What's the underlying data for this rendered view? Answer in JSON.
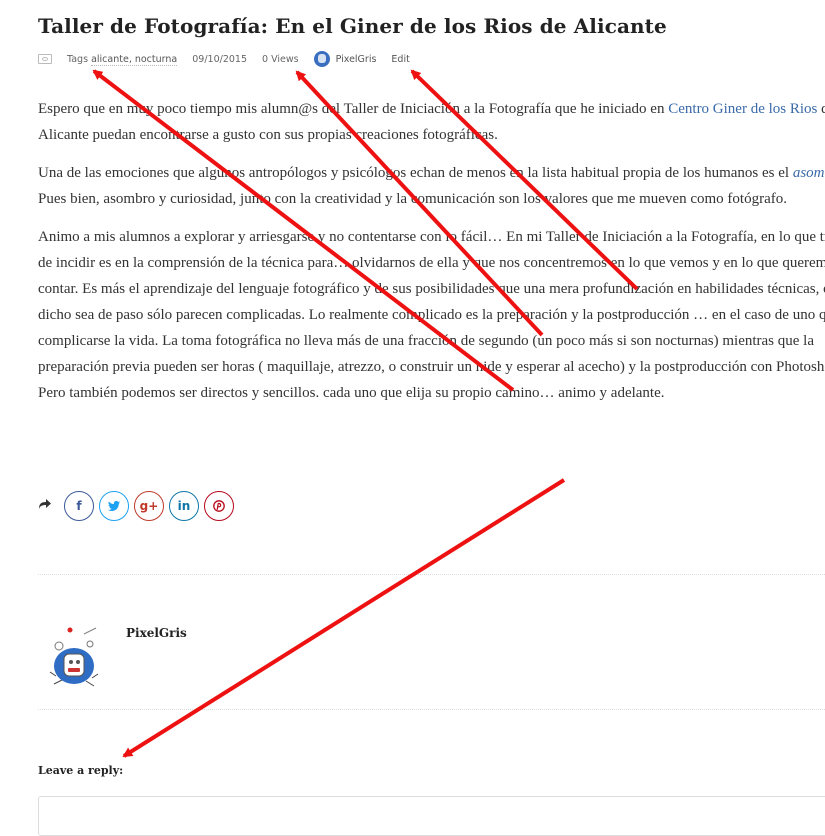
{
  "post": {
    "title": "Taller de Fotografía: En el Giner de los Rios de Alicante",
    "meta": {
      "tags_label": "Tags",
      "tags": "alicante, nocturna",
      "date": "09/10/2015",
      "views": "0 Views",
      "author": "PixelGris",
      "edit": "Edit"
    },
    "p1": {
      "before": "Espero que en muy poco tiempo mis alumn@s del Taller de Iniciación a la Fotografía que he iniciado en ",
      "link": "Centro Giner de los Rios",
      "after": " de Alicante puedan encontrarse a gusto con sus propias creaciones fotográficas."
    },
    "p2": {
      "before": "Una de las emociones que algunos antropólogos y psicólogos echan de menos en la lista habitual propia de los humanos es el ",
      "emph": "asombro",
      "after": ". Pues bien, asombro y curiosidad, junto con la creatividad y la comunicación son los valores que me mueven como fotógrafo."
    },
    "p3": "Animo a mis alumnos a explorar y arriesgarse y no contentarse con lo fácil… En mi Taller de Iniciación a la Fotografía, en lo que trato de incidir es en la comprensión de la técnica para… olvidarnos de ella y que nos concentremos en lo que vemos y en lo que queremos contar. Es más el aprendizaje del lenguaje fotográfico y de sus posibilidades que una mera profundización en habilidades técnicas, que dicho sea de paso sólo parecen complicadas. Lo realmente complicado es la preparación y la postproducción … en el caso de uno quiera complicarse la vida. La toma fotográfica no lleva más de una fracción de segundo (un poco más si son nocturnas) mientras que la preparación previa pueden ser horas ( maquillaje, atrezzo, o construir un hide y esperar al acecho) y la postproducción con Photoshop…  Pero también podemos ser directos  y sencillos. cada uno que elija su propio camino… animo y adelante."
  },
  "share": {
    "share_icon": "share-arrow-icon",
    "buttons": [
      {
        "icon": "facebook-icon",
        "glyph": "f"
      },
      {
        "icon": "twitter-icon",
        "glyph": "t"
      },
      {
        "icon": "google-plus-icon",
        "glyph": "g+"
      },
      {
        "icon": "linkedin-icon",
        "glyph": "in"
      },
      {
        "icon": "pinterest-icon",
        "glyph": "p"
      }
    ]
  },
  "author_box": {
    "name": "PixelGris"
  },
  "comments": {
    "reply_label": "Leave a reply:"
  },
  "colors": {
    "link": "#3a6aa8",
    "arrow": "#ee1111"
  }
}
